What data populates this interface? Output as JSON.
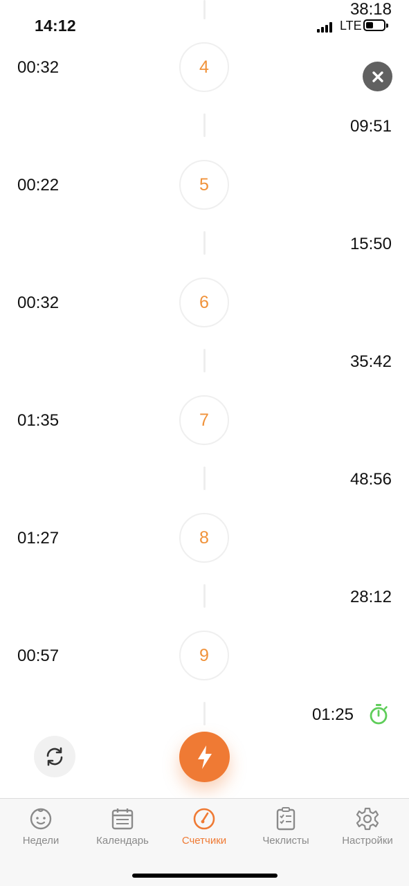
{
  "status_bar": {
    "time": "14:12",
    "network": "LTE"
  },
  "colors": {
    "accent": "#ef7a34",
    "number": "#f0923a",
    "timer_active": "#5fcd5a",
    "tab_inactive": "#8a8a8a"
  },
  "icons": {
    "close": "close-icon",
    "refresh": "refresh-icon",
    "action": "lightning-icon",
    "timer": "stopwatch-icon"
  },
  "timeline": {
    "top_gap": "38:18",
    "rows": [
      {
        "number": "4",
        "duration": "00:32",
        "gap_after": "09:51"
      },
      {
        "number": "5",
        "duration": "00:22",
        "gap_after": "15:50"
      },
      {
        "number": "6",
        "duration": "00:32",
        "gap_after": "35:42"
      },
      {
        "number": "7",
        "duration": "01:35",
        "gap_after": "48:56"
      },
      {
        "number": "8",
        "duration": "01:27",
        "gap_after": "28:12"
      },
      {
        "number": "9",
        "duration": "00:57",
        "gap_after": "01:25"
      }
    ]
  },
  "tabs": [
    {
      "label": "Недели",
      "icon": "baby-face-icon",
      "active": false
    },
    {
      "label": "Календарь",
      "icon": "calendar-icon",
      "active": false
    },
    {
      "label": "Счетчики",
      "icon": "gauge-icon",
      "active": true
    },
    {
      "label": "Чеклисты",
      "icon": "checklist-icon",
      "active": false
    },
    {
      "label": "Настройки",
      "icon": "gear-icon",
      "active": false
    }
  ]
}
